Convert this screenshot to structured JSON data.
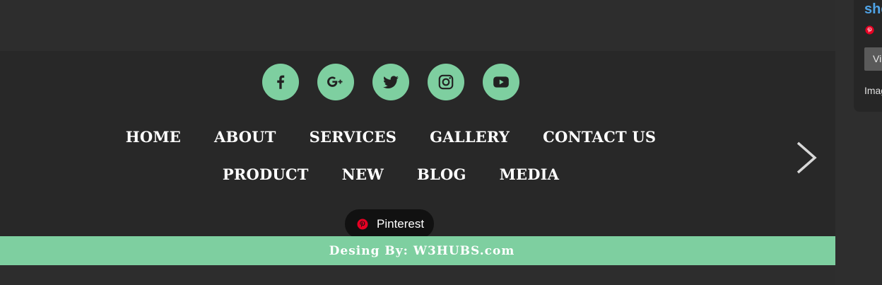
{
  "social": [
    {
      "name": "facebook",
      "icon": "facebook-icon"
    },
    {
      "name": "google-plus",
      "icon": "google-plus-icon"
    },
    {
      "name": "twitter",
      "icon": "twitter-icon"
    },
    {
      "name": "instagram",
      "icon": "instagram-icon"
    },
    {
      "name": "youtube",
      "icon": "youtube-icon"
    }
  ],
  "nav": {
    "row1": [
      "HOME",
      "ABOUT",
      "SERVICES",
      "GALLERY",
      "CONTACT US"
    ],
    "row2": [
      "PRODUCT",
      "NEW",
      "BLOG",
      "MEDIA"
    ]
  },
  "pinterest": {
    "label": "Pinterest"
  },
  "credit": {
    "text": "Desing By: W3HUBS.com"
  },
  "side": {
    "title": "she",
    "button": "Vi",
    "text": "Imag"
  },
  "colors": {
    "accent": "#7ecfa0",
    "background": "#282828",
    "pinterest_red": "#e60023",
    "link_blue": "#4fa3e6"
  }
}
